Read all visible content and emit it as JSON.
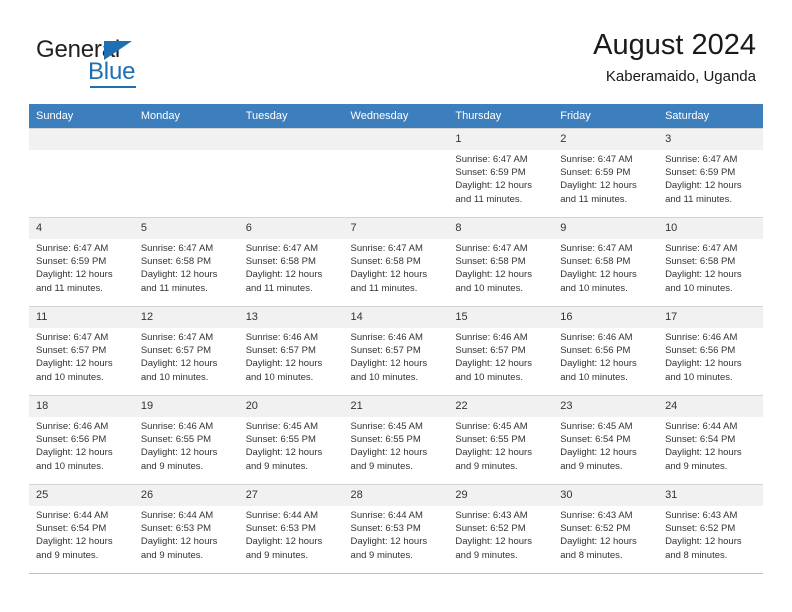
{
  "logo": {
    "word_top": "General",
    "word_bottom": "Blue",
    "accent_color": "#1f6fb5"
  },
  "header": {
    "title": "August 2024",
    "subtitle": "Kaberamaido, Uganda"
  },
  "calendar": {
    "header_bg": "#3d7ebd",
    "daynum_bg": "#f1f1f1",
    "weekday_headers": [
      "Sunday",
      "Monday",
      "Tuesday",
      "Wednesday",
      "Thursday",
      "Friday",
      "Saturday"
    ],
    "labels": {
      "sunrise": "Sunrise:",
      "sunset": "Sunset:",
      "daylight": "Daylight:"
    },
    "weeks": [
      [
        {
          "day": "",
          "sunrise": "",
          "sunset": "",
          "daylight": ""
        },
        {
          "day": "",
          "sunrise": "",
          "sunset": "",
          "daylight": ""
        },
        {
          "day": "",
          "sunrise": "",
          "sunset": "",
          "daylight": ""
        },
        {
          "day": "",
          "sunrise": "",
          "sunset": "",
          "daylight": ""
        },
        {
          "day": "1",
          "sunrise": "Sunrise: 6:47 AM",
          "sunset": "Sunset: 6:59 PM",
          "daylight": "Daylight: 12 hours and 11 minutes."
        },
        {
          "day": "2",
          "sunrise": "Sunrise: 6:47 AM",
          "sunset": "Sunset: 6:59 PM",
          "daylight": "Daylight: 12 hours and 11 minutes."
        },
        {
          "day": "3",
          "sunrise": "Sunrise: 6:47 AM",
          "sunset": "Sunset: 6:59 PM",
          "daylight": "Daylight: 12 hours and 11 minutes."
        }
      ],
      [
        {
          "day": "4",
          "sunrise": "Sunrise: 6:47 AM",
          "sunset": "Sunset: 6:59 PM",
          "daylight": "Daylight: 12 hours and 11 minutes."
        },
        {
          "day": "5",
          "sunrise": "Sunrise: 6:47 AM",
          "sunset": "Sunset: 6:58 PM",
          "daylight": "Daylight: 12 hours and 11 minutes."
        },
        {
          "day": "6",
          "sunrise": "Sunrise: 6:47 AM",
          "sunset": "Sunset: 6:58 PM",
          "daylight": "Daylight: 12 hours and 11 minutes."
        },
        {
          "day": "7",
          "sunrise": "Sunrise: 6:47 AM",
          "sunset": "Sunset: 6:58 PM",
          "daylight": "Daylight: 12 hours and 11 minutes."
        },
        {
          "day": "8",
          "sunrise": "Sunrise: 6:47 AM",
          "sunset": "Sunset: 6:58 PM",
          "daylight": "Daylight: 12 hours and 10 minutes."
        },
        {
          "day": "9",
          "sunrise": "Sunrise: 6:47 AM",
          "sunset": "Sunset: 6:58 PM",
          "daylight": "Daylight: 12 hours and 10 minutes."
        },
        {
          "day": "10",
          "sunrise": "Sunrise: 6:47 AM",
          "sunset": "Sunset: 6:58 PM",
          "daylight": "Daylight: 12 hours and 10 minutes."
        }
      ],
      [
        {
          "day": "11",
          "sunrise": "Sunrise: 6:47 AM",
          "sunset": "Sunset: 6:57 PM",
          "daylight": "Daylight: 12 hours and 10 minutes."
        },
        {
          "day": "12",
          "sunrise": "Sunrise: 6:47 AM",
          "sunset": "Sunset: 6:57 PM",
          "daylight": "Daylight: 12 hours and 10 minutes."
        },
        {
          "day": "13",
          "sunrise": "Sunrise: 6:46 AM",
          "sunset": "Sunset: 6:57 PM",
          "daylight": "Daylight: 12 hours and 10 minutes."
        },
        {
          "day": "14",
          "sunrise": "Sunrise: 6:46 AM",
          "sunset": "Sunset: 6:57 PM",
          "daylight": "Daylight: 12 hours and 10 minutes."
        },
        {
          "day": "15",
          "sunrise": "Sunrise: 6:46 AM",
          "sunset": "Sunset: 6:57 PM",
          "daylight": "Daylight: 12 hours and 10 minutes."
        },
        {
          "day": "16",
          "sunrise": "Sunrise: 6:46 AM",
          "sunset": "Sunset: 6:56 PM",
          "daylight": "Daylight: 12 hours and 10 minutes."
        },
        {
          "day": "17",
          "sunrise": "Sunrise: 6:46 AM",
          "sunset": "Sunset: 6:56 PM",
          "daylight": "Daylight: 12 hours and 10 minutes."
        }
      ],
      [
        {
          "day": "18",
          "sunrise": "Sunrise: 6:46 AM",
          "sunset": "Sunset: 6:56 PM",
          "daylight": "Daylight: 12 hours and 10 minutes."
        },
        {
          "day": "19",
          "sunrise": "Sunrise: 6:46 AM",
          "sunset": "Sunset: 6:55 PM",
          "daylight": "Daylight: 12 hours and 9 minutes."
        },
        {
          "day": "20",
          "sunrise": "Sunrise: 6:45 AM",
          "sunset": "Sunset: 6:55 PM",
          "daylight": "Daylight: 12 hours and 9 minutes."
        },
        {
          "day": "21",
          "sunrise": "Sunrise: 6:45 AM",
          "sunset": "Sunset: 6:55 PM",
          "daylight": "Daylight: 12 hours and 9 minutes."
        },
        {
          "day": "22",
          "sunrise": "Sunrise: 6:45 AM",
          "sunset": "Sunset: 6:55 PM",
          "daylight": "Daylight: 12 hours and 9 minutes."
        },
        {
          "day": "23",
          "sunrise": "Sunrise: 6:45 AM",
          "sunset": "Sunset: 6:54 PM",
          "daylight": "Daylight: 12 hours and 9 minutes."
        },
        {
          "day": "24",
          "sunrise": "Sunrise: 6:44 AM",
          "sunset": "Sunset: 6:54 PM",
          "daylight": "Daylight: 12 hours and 9 minutes."
        }
      ],
      [
        {
          "day": "25",
          "sunrise": "Sunrise: 6:44 AM",
          "sunset": "Sunset: 6:54 PM",
          "daylight": "Daylight: 12 hours and 9 minutes."
        },
        {
          "day": "26",
          "sunrise": "Sunrise: 6:44 AM",
          "sunset": "Sunset: 6:53 PM",
          "daylight": "Daylight: 12 hours and 9 minutes."
        },
        {
          "day": "27",
          "sunrise": "Sunrise: 6:44 AM",
          "sunset": "Sunset: 6:53 PM",
          "daylight": "Daylight: 12 hours and 9 minutes."
        },
        {
          "day": "28",
          "sunrise": "Sunrise: 6:44 AM",
          "sunset": "Sunset: 6:53 PM",
          "daylight": "Daylight: 12 hours and 9 minutes."
        },
        {
          "day": "29",
          "sunrise": "Sunrise: 6:43 AM",
          "sunset": "Sunset: 6:52 PM",
          "daylight": "Daylight: 12 hours and 9 minutes."
        },
        {
          "day": "30",
          "sunrise": "Sunrise: 6:43 AM",
          "sunset": "Sunset: 6:52 PM",
          "daylight": "Daylight: 12 hours and 8 minutes."
        },
        {
          "day": "31",
          "sunrise": "Sunrise: 6:43 AM",
          "sunset": "Sunset: 6:52 PM",
          "daylight": "Daylight: 12 hours and 8 minutes."
        }
      ]
    ]
  }
}
